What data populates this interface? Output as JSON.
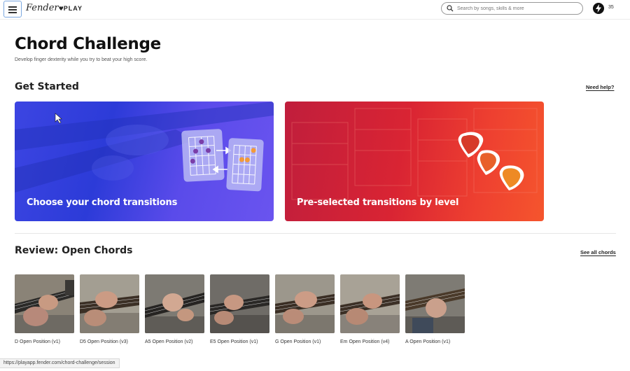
{
  "header": {
    "logo_script": "Fender",
    "logo_play": "PLAY",
    "search_placeholder": "Search by songs, skills & more",
    "streak_count": "35"
  },
  "page": {
    "title": "Chord Challenge",
    "subtitle": "Develop finger dexterity while you try to beat your high score."
  },
  "get_started": {
    "title": "Get Started",
    "help_link": "Need help?",
    "cards": [
      {
        "label": "Choose your chord transitions",
        "color": "#3440dc"
      },
      {
        "label": "Pre-selected transitions by level",
        "color": "#e12f32"
      }
    ]
  },
  "review": {
    "title": "Review: Open Chords",
    "see_all": "See all chords",
    "chords": [
      {
        "label": "D Open Position (v1)"
      },
      {
        "label": "D5 Open Position (v3)"
      },
      {
        "label": "A5 Open Position (v2)"
      },
      {
        "label": "E5 Open Position (v1)"
      },
      {
        "label": "G Open Position (v1)"
      },
      {
        "label": "Em Open Position (v4)"
      },
      {
        "label": "A Open Position (v1)"
      }
    ]
  },
  "status_bar": {
    "url": "https://playapp.fender.com/chord-challenge/session"
  }
}
